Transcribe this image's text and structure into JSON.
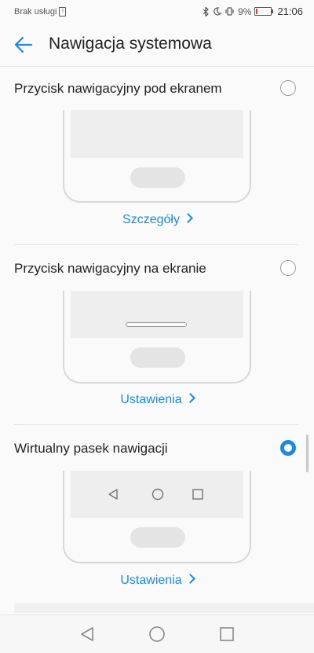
{
  "status_bar": {
    "carrier": "Brak usługi",
    "sim_icon": "sim-card-icon",
    "battery_percent": "9%",
    "battery_level": 0.09,
    "time": "21:06",
    "icons": [
      "bluetooth-icon",
      "moon-icon",
      "vibrate-icon",
      "battery-icon"
    ]
  },
  "header": {
    "title": "Nawigacja systemowa",
    "back_icon": "back-arrow-icon"
  },
  "options": [
    {
      "label": "Przycisk nawigacyjny pod ekranem",
      "selected": false,
      "link": "Szczegóły"
    },
    {
      "label": "Przycisk nawigacyjny na ekranie",
      "selected": false,
      "link": "Ustawienia"
    },
    {
      "label": "Wirtualny pasek nawigacji",
      "selected": true,
      "link": "Ustawienia"
    }
  ],
  "colors": {
    "accent": "#1e88e5",
    "background": "#fafafa",
    "battery_low": "#e53935"
  },
  "system_nav": [
    "back-triangle-icon",
    "home-circle-icon",
    "recents-square-icon"
  ]
}
